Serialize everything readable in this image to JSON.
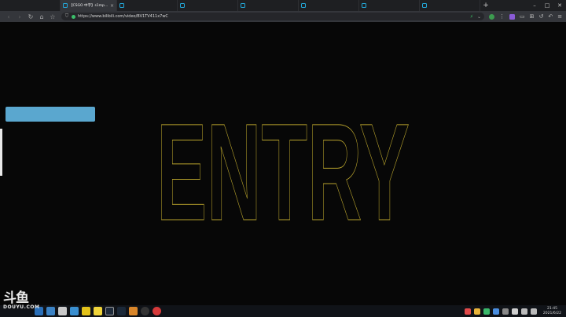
{
  "tabs": [
    {
      "title": "",
      "active": false,
      "first": true
    },
    {
      "title": "【CSGO 中字】s1mple…",
      "active": true
    },
    {
      "title": "",
      "active": false
    },
    {
      "title": "",
      "active": false
    },
    {
      "title": "",
      "active": false
    },
    {
      "title": "",
      "active": false
    },
    {
      "title": "",
      "active": false
    },
    {
      "title": "",
      "active": false
    }
  ],
  "address": {
    "url": "https://www.bilibili.com/video/BV1TV411x7wC"
  },
  "page": {
    "hero_text": "ENTRY",
    "colors": {
      "hero_stroke": "#b8a32c",
      "blue_bar": "#5aa7cf",
      "background": "#070707"
    }
  },
  "clock": {
    "time": "21:45",
    "date": "2021/6/22"
  },
  "watermark": {
    "logo_text": "斗鱼",
    "site": "DOUYU.COM"
  }
}
